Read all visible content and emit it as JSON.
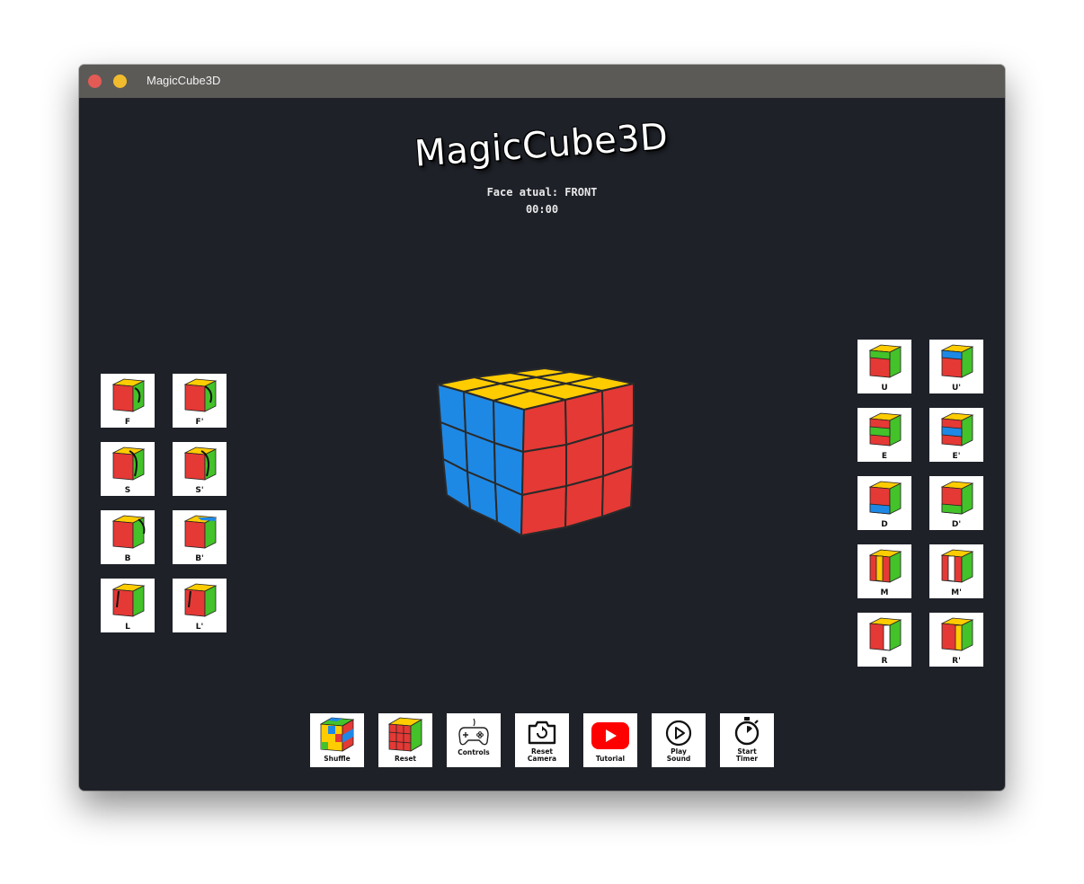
{
  "window": {
    "title": "MagicCube3D"
  },
  "header": {
    "logo": "MagicCube3D",
    "face_status": "Face atual: FRONT",
    "timer": "00:00"
  },
  "colors": {
    "background": "#1e2128",
    "cube_red": "#e53935",
    "cube_blue": "#1e88e5",
    "cube_yellow": "#ffcc00",
    "cube_green": "#43c229",
    "youtube_red": "#ff0000"
  },
  "left_moves": [
    {
      "label": "F"
    },
    {
      "label": "F'"
    },
    {
      "label": "S"
    },
    {
      "label": "S'"
    },
    {
      "label": "B"
    },
    {
      "label": "B'"
    },
    {
      "label": "L"
    },
    {
      "label": "L'"
    }
  ],
  "right_moves": [
    {
      "label": "U"
    },
    {
      "label": "U'"
    },
    {
      "label": "E"
    },
    {
      "label": "E'"
    },
    {
      "label": "D"
    },
    {
      "label": "D'"
    },
    {
      "label": "M"
    },
    {
      "label": "M'"
    },
    {
      "label": "R"
    },
    {
      "label": "R'"
    }
  ],
  "toolbar": {
    "shuffle": "Shuffle",
    "reset": "Reset",
    "controls": "Controls",
    "reset_camera_1": "Reset",
    "reset_camera_2": "Camera",
    "tutorial": "Tutorial",
    "play_sound_1": "Play",
    "play_sound_2": "Sound",
    "start_timer_1": "Start",
    "start_timer_2": "Timer"
  }
}
